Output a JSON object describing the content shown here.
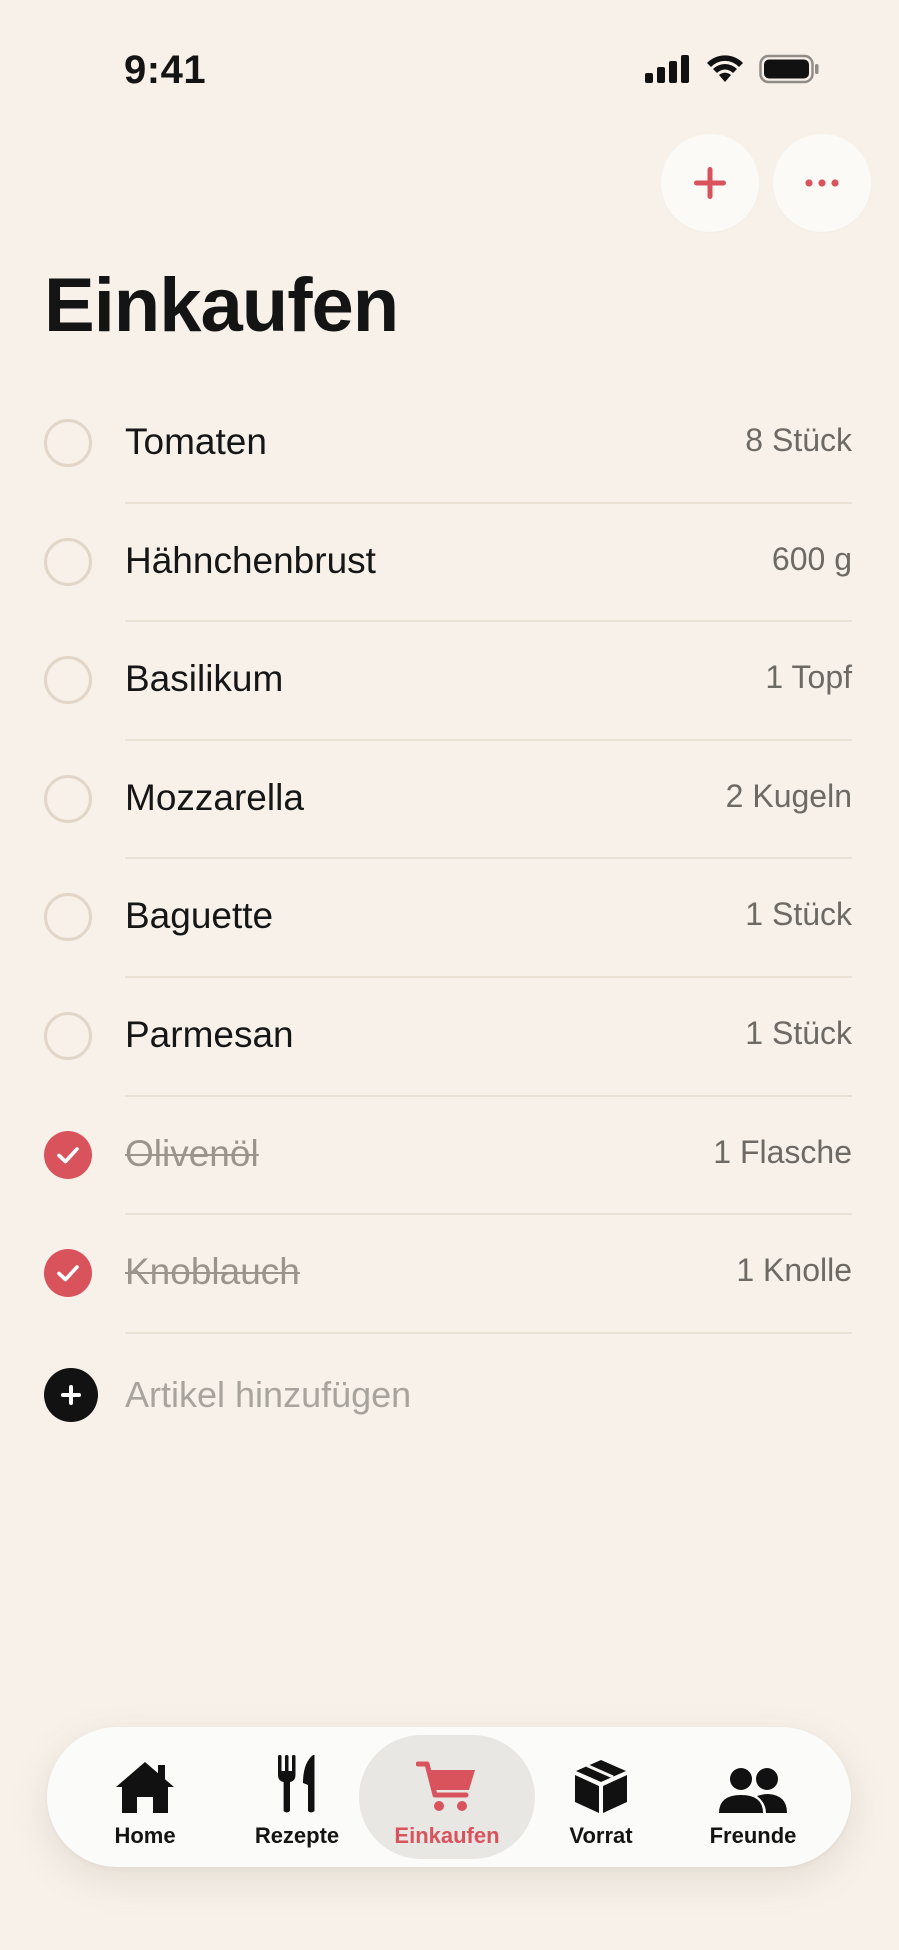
{
  "status": {
    "time": "9:41"
  },
  "header": {
    "title": "Einkaufen",
    "add_icon": "plus-icon",
    "more_icon": "ellipsis-icon"
  },
  "colors": {
    "accent": "#d9535d",
    "background": "#f7f1ea"
  },
  "items": [
    {
      "name": "Tomaten",
      "qty": "8 Stück",
      "checked": false
    },
    {
      "name": "Hähnchenbrust",
      "qty": "600 g",
      "checked": false
    },
    {
      "name": "Basilikum",
      "qty": "1 Topf",
      "checked": false
    },
    {
      "name": "Mozzarella",
      "qty": "2 Kugeln",
      "checked": false
    },
    {
      "name": "Baguette",
      "qty": "1 Stück",
      "checked": false
    },
    {
      "name": "Parmesan",
      "qty": "1 Stück",
      "checked": false
    },
    {
      "name": "Olivenöl",
      "qty": "1 Flasche",
      "checked": true
    },
    {
      "name": "Knoblauch",
      "qty": "1 Knolle",
      "checked": true
    }
  ],
  "add_item": {
    "label": "Artikel hinzufügen"
  },
  "tabs": [
    {
      "label": "Home",
      "icon": "house-icon",
      "active": false
    },
    {
      "label": "Rezepte",
      "icon": "fork-knife-icon",
      "active": false
    },
    {
      "label": "Einkaufen",
      "icon": "cart-icon",
      "active": true
    },
    {
      "label": "Vorrat",
      "icon": "box-icon",
      "active": false
    },
    {
      "label": "Freunde",
      "icon": "people-icon",
      "active": false
    }
  ]
}
